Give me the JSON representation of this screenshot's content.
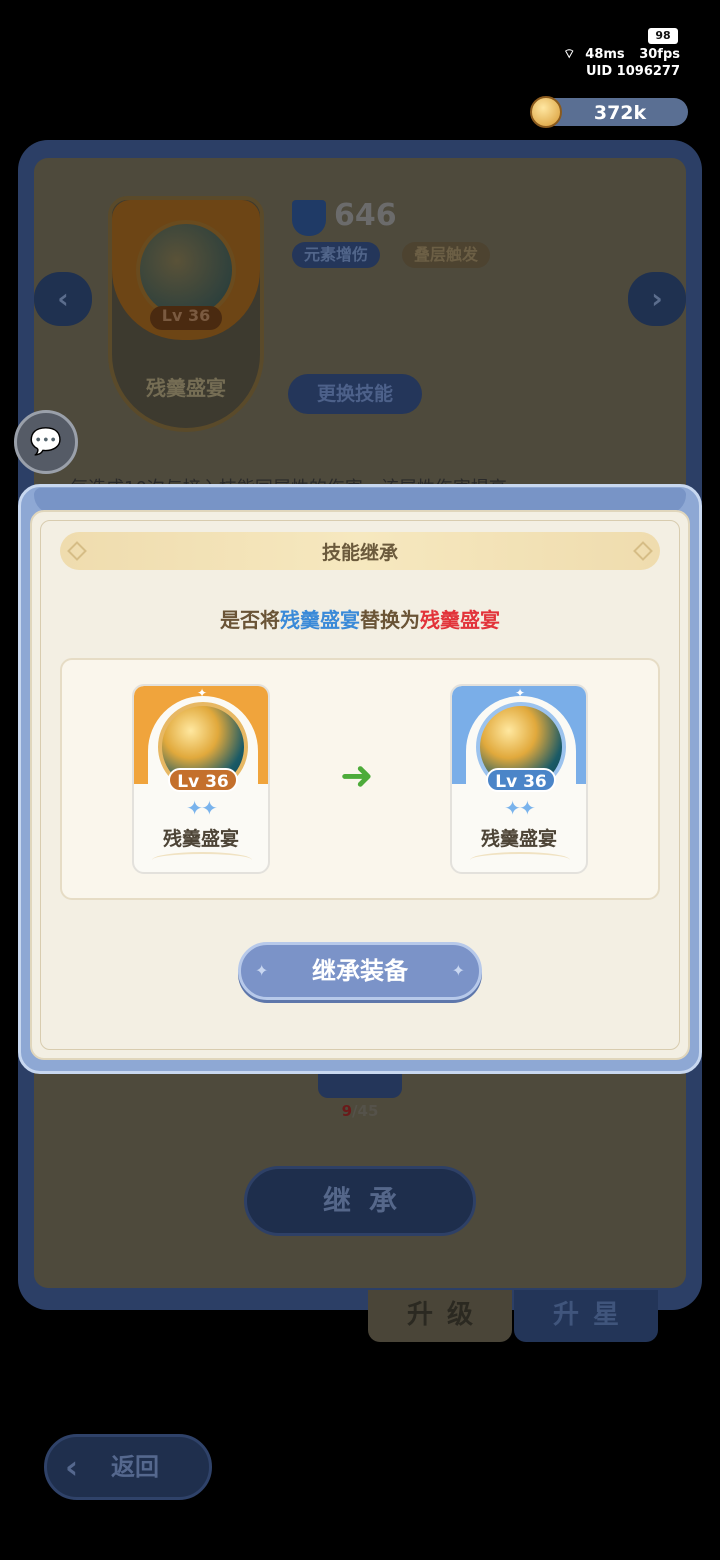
{
  "status": {
    "battery": "98",
    "ping": "48ms",
    "fps": "30fps",
    "uid": "UID 1096277"
  },
  "currency": {
    "value": "372k",
    "icon": "coin-icon"
  },
  "background": {
    "skill_name": "残羹盛宴",
    "level": "Lv 36",
    "power": "646",
    "tags": [
      "元素增伤",
      "叠层触发"
    ],
    "change_skill_label": "更换技能",
    "description_snippet": "每造成10次与接入技能同属性的伤害，该属性伤害提高",
    "progress_current": "9",
    "progress_total": "/45",
    "inherit_label": "继承",
    "tabs": [
      "升级",
      "升星"
    ],
    "back_label": "返回"
  },
  "modal": {
    "title": "技能继承",
    "question_prefix": "是否将",
    "from_name": "残羹盛宴",
    "question_mid": "替换为",
    "to_name": "残羹盛宴",
    "from_card": {
      "level": "Lv 36",
      "name": "残羹盛宴",
      "stars": "✦✦"
    },
    "to_card": {
      "level": "Lv 36",
      "name": "残羹盛宴",
      "stars": "✦✦"
    },
    "confirm_label": "继承装备",
    "colors": {
      "from": "#3a8ad8",
      "to": "#e2333a",
      "arrow": "#4dab3a"
    }
  }
}
